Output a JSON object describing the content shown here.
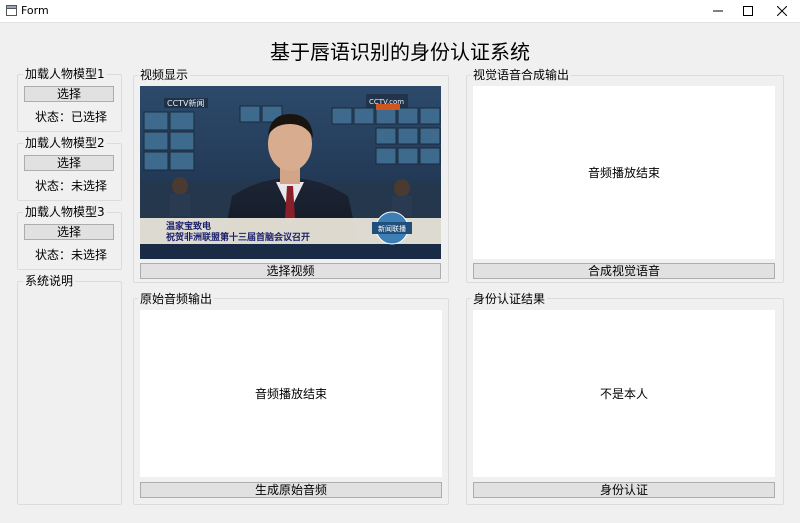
{
  "window": {
    "title": "Form"
  },
  "app_title": "基于唇语识别的身份认证系统",
  "models": [
    {
      "title": "加载人物模型1",
      "button": "选择",
      "status": "状态：已选择"
    },
    {
      "title": "加载人物模型2",
      "button": "选择",
      "status": "状态：未选择"
    },
    {
      "title": "加载人物模型3",
      "button": "选择",
      "status": "状态：未选择"
    }
  ],
  "system_info": {
    "title": "系统说明"
  },
  "video_panel": {
    "title": "视频显示",
    "button": "选择视频",
    "frame": {
      "logo_top": "CCTV新闻",
      "logo_right": "CCTV.com",
      "tag": "新闻联播",
      "caption_line1": "温家宝致电",
      "caption_line2": "祝贺非洲联盟第十三届首脑会议召开"
    }
  },
  "synth_panel": {
    "title": "视觉语音合成输出",
    "status": "音频播放结束",
    "button": "合成视觉语音"
  },
  "orig_audio_panel": {
    "title": "原始音频输出",
    "status": "音频播放结束",
    "button": "生成原始音频"
  },
  "auth_panel": {
    "title": "身份认证结果",
    "result": "不是本人",
    "button": "身份认证"
  },
  "colors": {
    "window_bg": "#f0f0f0",
    "button_bg": "#e1e1e1",
    "button_border": "#adadad"
  }
}
